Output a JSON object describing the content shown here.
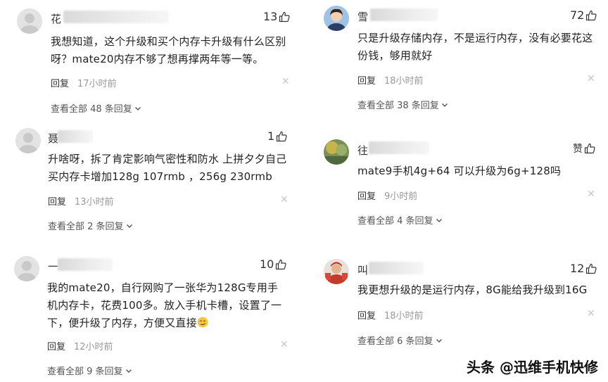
{
  "comments": [
    {
      "name": "花",
      "likes": "13",
      "text": "我想知道，这个升级和买个内存卡升级有什么区别呀？mate20内存不够了想再撑两年等一等。",
      "reply_label": "回复",
      "time": "17小时前",
      "more": "查看全部 48 条回复"
    },
    {
      "name": "聂",
      "likes": "1",
      "text": "升啥呀，拆了肯定影响气密性和防水 上拼夕夕自己买内存卡增加128g 107rmb ，256g 230rmb",
      "reply_label": "回复",
      "time": "13小时前",
      "more": "查看全部 2 条回复"
    },
    {
      "name": "一",
      "likes": "10",
      "text": "我的mate20，自行网购了一张华为128G专用手机内存卡，花费100多。放入手机卡槽，设置了一下，便升级了内存，方便又直接",
      "reply_label": "回复",
      "time": "12小时前",
      "more": "查看全部 9 条回复"
    },
    {
      "name": "雪",
      "likes": "72",
      "text": "只是升级存储内存，不是运行内存，没有必要花这份钱，够用就好",
      "reply_label": "回复",
      "time": "18小时前",
      "more": "查看全部 38 条回复"
    },
    {
      "name": "往",
      "likes": "赞",
      "text": "mate9手机4g+64 可以升级为6g+128吗",
      "reply_label": "回复",
      "time": "9小时前",
      "more": "查看全部 4 条回复"
    },
    {
      "name": "叫",
      "likes": "12",
      "text": "我更想升级的是运行内存，8G能给我升级到16G",
      "reply_label": "回复",
      "time": "18小时前",
      "more": "查看全部 6 条回复"
    }
  ],
  "watermark": "头条 @迅维手机快修",
  "icons": {
    "like": "thumbs-up-icon",
    "close": "close-icon",
    "expand": "chevron-down-icon",
    "avatar": "avatar"
  }
}
